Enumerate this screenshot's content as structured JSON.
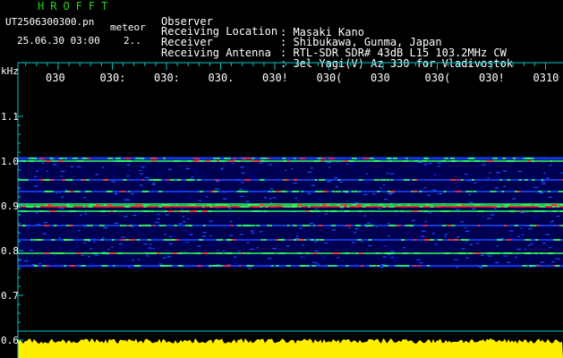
{
  "header": {
    "brand": "HROFFT",
    "file_name": "UT2506300300.pn",
    "mode_tag": "meteor",
    "timestamp": "25.06.30 03:00",
    "counter": "2.."
  },
  "station_info": [
    {
      "label": "Observer",
      "value": ": Masaki Kano"
    },
    {
      "label": "Receiving Location",
      "value": ": Shibukawa, Gunma, Japan"
    },
    {
      "label": "Receiver",
      "value": ": RTL-SDR SDR# 43dB L15 103.2MHz CW"
    },
    {
      "label": "Receiving Antenna",
      "value": ": 3el Yagi(V) Az 330 for Vladivostok"
    }
  ],
  "axis": {
    "unit": "kHz",
    "x_ticks": [
      "030",
      "030:",
      "030:",
      "030.",
      "030!",
      "030(",
      "030",
      "030(",
      "030!",
      "0310"
    ],
    "y_ticks": [
      {
        "label": "1.1",
        "value": 1.1
      },
      {
        "label": "1.0",
        "value": 1.0
      },
      {
        "label": "0.9",
        "value": 0.9
      },
      {
        "label": "0.8",
        "value": 0.8
      },
      {
        "label": "0.7",
        "value": 0.7
      },
      {
        "label": "0.6",
        "value": 0.6
      }
    ]
  },
  "colors": {
    "background": "#000000",
    "brand": "#26d626",
    "axis": "#00c8c8",
    "noise_floor": "#00009a",
    "noise_mid": "#1a4cff",
    "signal_strong": "#ff2a2a",
    "signal_green": "#2cff5a",
    "amplitude": "#ffee00"
  }
}
